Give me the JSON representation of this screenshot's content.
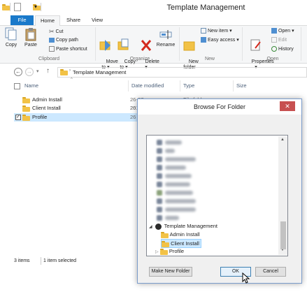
{
  "window": {
    "title": "Template Management"
  },
  "tabs": [
    {
      "label": "File"
    },
    {
      "label": "Home"
    },
    {
      "label": "Share"
    },
    {
      "label": "View"
    }
  ],
  "ribbon": {
    "clipboard": {
      "group_label": "Clipboard",
      "copy": "Copy",
      "paste": "Paste",
      "cut": "Cut",
      "copy_path": "Copy path",
      "paste_shortcut": "Paste shortcut"
    },
    "organize": {
      "group_label": "Organize",
      "move_to": "Move\nto ▾",
      "copy_to": "Copy\nto ▾",
      "delete": "Delete\n▾",
      "rename": "Rename"
    },
    "new": {
      "group_label": "New",
      "new_folder": "New\nfolder",
      "new_item": "New item ▾",
      "easy_access": "Easy access ▾"
    },
    "open": {
      "group_label": "Open",
      "properties": "Properties\n▾",
      "open": "Open ▾",
      "edit": "Edit",
      "history": "History"
    }
  },
  "addressbar": {
    "path": "Template Management"
  },
  "columns": {
    "name": "Name",
    "date": "Date modified",
    "type": "Type",
    "size": "Size"
  },
  "files": [
    {
      "name": "Admin Install",
      "date": "26-07-2016 12:55",
      "type": "File folder"
    },
    {
      "name": "Client Install",
      "date": "26"
    },
    {
      "name": "Profile",
      "date": "26"
    }
  ],
  "status": {
    "items": "3 items",
    "selected": "1 item selected"
  },
  "dialog": {
    "title": "Browse For Folder",
    "tree": {
      "root": "Template Management",
      "children": [
        "Admin Install",
        "Client Install",
        "Profile"
      ],
      "selected": "Client Install"
    },
    "buttons": {
      "new_folder": "Make New Folder",
      "ok": "OK",
      "cancel": "Cancel"
    }
  },
  "colors": {
    "file_tab": "#1979ca",
    "selection": "#cce8ff",
    "close": "#c75050",
    "folder": "#f2c246"
  }
}
